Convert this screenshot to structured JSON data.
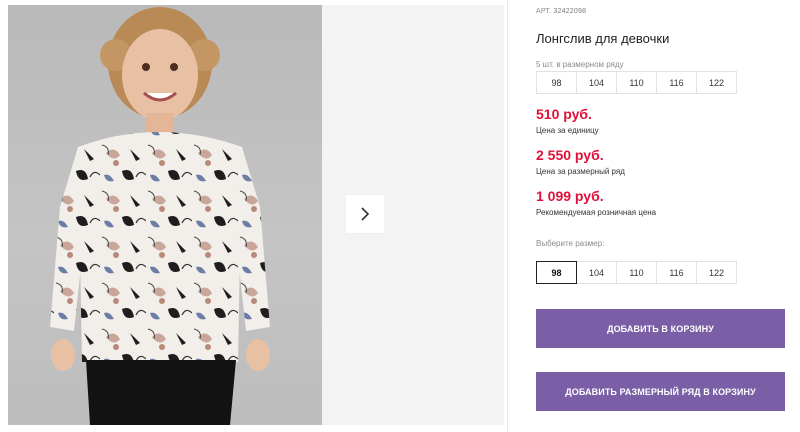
{
  "gallery": {
    "next_icon": "chevron-right-icon"
  },
  "product": {
    "art_label": "АРТ.",
    "art_number": "32422098",
    "title": "Лонгслив для девочки",
    "size_run_hint": "5 шт. в размерном ряду",
    "size_run": [
      "98",
      "104",
      "110",
      "116",
      "122"
    ],
    "price_unit": "510 руб.",
    "price_unit_label": "Цена за единицу",
    "price_run": "2 550 руб.",
    "price_run_label": "Цена за размерный ряд",
    "price_retail": "1 099 руб.",
    "price_retail_label": "Рекомендуемая розничная цена",
    "choose_size_label": "Выберите размер:",
    "sizes": [
      "98",
      "104",
      "110",
      "116",
      "122"
    ],
    "selected_size": "98",
    "add_to_cart": "ДОБАВИТЬ В КОРЗИНУ",
    "add_run_to_cart": "ДОБАВИТЬ РАЗМЕРНЫЙ РЯД В КОРЗИНУ"
  },
  "colors": {
    "price": "#e0103a",
    "button": "#7a5fa6"
  }
}
